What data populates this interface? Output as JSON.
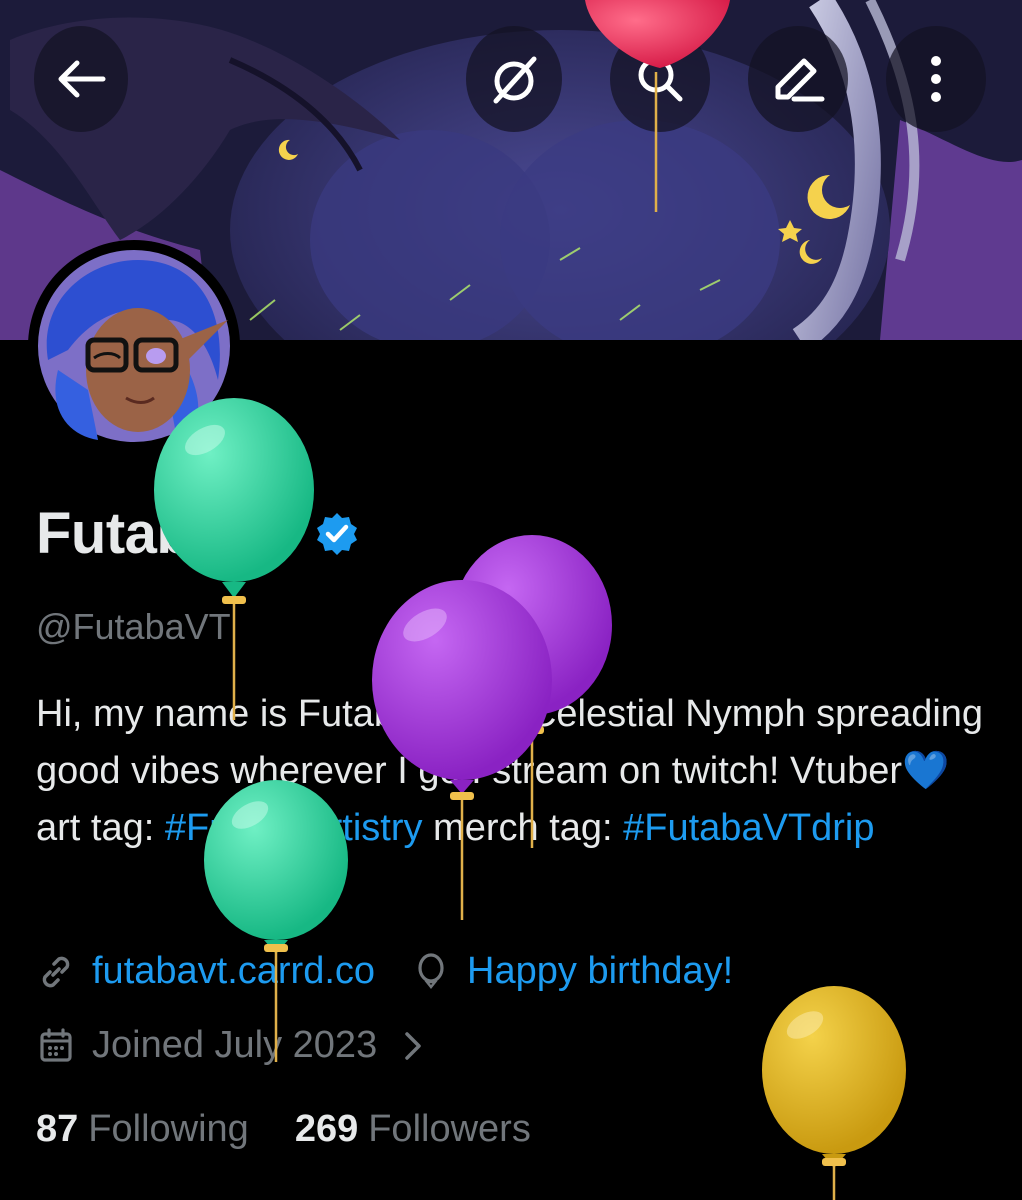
{
  "header": {
    "buttons": [
      {
        "name": "back-button",
        "icon": "arrow-left-icon"
      },
      {
        "name": "grok-button",
        "icon": "slashed-circle-icon"
      },
      {
        "name": "search-button",
        "icon": "search-icon"
      },
      {
        "name": "edit-button",
        "icon": "pencil-icon"
      },
      {
        "name": "more-button",
        "icon": "dots-vertical-icon"
      }
    ]
  },
  "profile": {
    "name": "FutabaVT",
    "verified": true,
    "handle": "@FutabaVT",
    "bio": {
      "line1_part1": "Hi, my name is Futaba! I'm a Celestial Nymph spreading good vibes wherever I go  I stream on twitch! Vtuber",
      "emoji": "💙",
      "part2": " art tag: ",
      "tag1": "#FutabaArtistry",
      "part3": " merch tag: ",
      "tag2": "#FutabaVTdrip"
    },
    "website": "futabavt.carrd.co",
    "location": "Happy birthday!",
    "joined": "Joined July 2023",
    "following_count": "87",
    "following_label": "Following",
    "followers_count": "269",
    "followers_label": "Followers"
  },
  "colors": {
    "accent": "#1d9bf0",
    "muted": "#71767b",
    "text": "#e7e9ea",
    "background": "#000000",
    "balloon_green": "#2fd39a",
    "balloon_purple": "#a23ad6",
    "balloon_gold": "#e3b51c",
    "balloon_red": "#e8305a"
  }
}
